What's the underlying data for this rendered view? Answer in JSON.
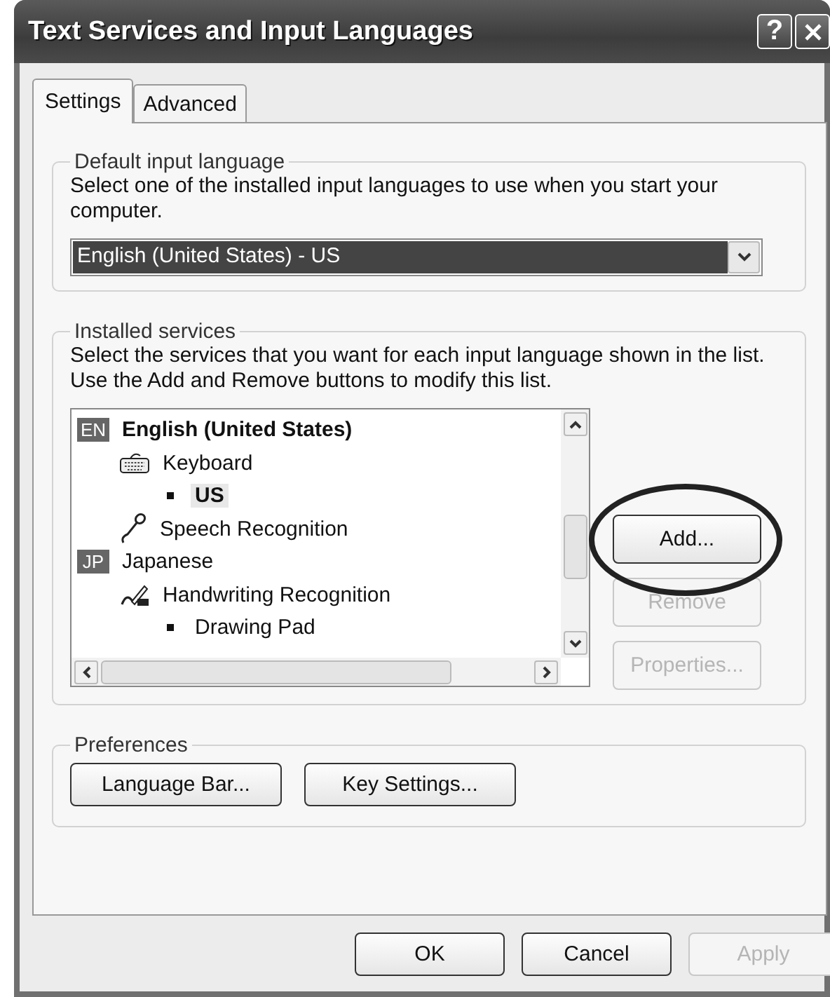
{
  "window": {
    "title": "Text Services and Input Languages",
    "help_button": "?"
  },
  "tabs": [
    {
      "label": "Settings",
      "selected": true
    },
    {
      "label": "Advanced",
      "selected": false
    }
  ],
  "default_input_language": {
    "legend": "Default input language",
    "description": "Select one of the installed input languages to use when you start your computer.",
    "dropdown": {
      "value": "English (United States) - US",
      "focused": true
    }
  },
  "installed_services": {
    "legend": "Installed services",
    "description": "Select the services that you want for each input language shown in the list. Use the Add and Remove buttons to modify this list.",
    "tree": [
      {
        "kind": "language",
        "badge": "EN",
        "label": "English (United States)",
        "bold": true,
        "selected": false,
        "children": [
          {
            "kind": "keyboard",
            "label": "Keyboard",
            "selected": false,
            "children": [
              {
                "kind": "layout",
                "label": "US",
                "bold": true,
                "selected": true
              }
            ]
          },
          {
            "kind": "speech",
            "label": "Speech Recognition",
            "selected": false
          }
        ]
      },
      {
        "kind": "language",
        "badge": "JP",
        "label": "Japanese",
        "bold": false,
        "selected": false,
        "children": [
          {
            "kind": "handwriting",
            "label": "Handwriting Recognition",
            "selected": false,
            "children": [
              {
                "kind": "layout",
                "label": "Drawing Pad",
                "bold": false,
                "selected": false
              }
            ]
          }
        ]
      }
    ],
    "buttons": [
      {
        "label": "Add...",
        "disabled": false,
        "circled": true
      },
      {
        "label": "Remove",
        "disabled": true,
        "circled": false
      },
      {
        "label": "Properties...",
        "disabled": true,
        "circled": false
      }
    ]
  },
  "preferences": {
    "legend": "Preferences",
    "buttons": [
      {
        "label": "Language Bar...",
        "disabled": false
      },
      {
        "label": "Key Settings...",
        "disabled": false
      }
    ]
  },
  "footer_buttons": [
    {
      "label": "OK",
      "disabled": false
    },
    {
      "label": "Cancel",
      "disabled": false
    },
    {
      "label": "Apply",
      "disabled": true
    }
  ]
}
